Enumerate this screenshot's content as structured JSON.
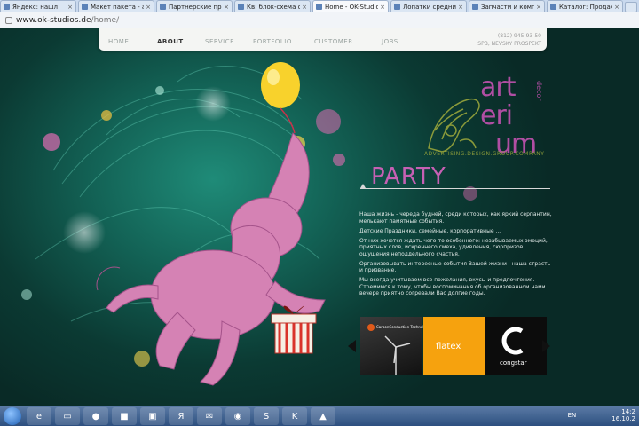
{
  "browser": {
    "tabs": [
      {
        "label": "Яндекс: нашл"
      },
      {
        "label": "Макет пакета - abit"
      },
      {
        "label": "Партнерские предл"
      },
      {
        "label": "Кв: блок-схема сло"
      },
      {
        "label": "Home - OK-Studios"
      },
      {
        "label": "Лопатки средние Рe"
      },
      {
        "label": "Запчасти и компле"
      },
      {
        "label": "Каталог: Продажа с"
      }
    ],
    "tab_close": "×",
    "url_host": "www.ok-studios.de",
    "url_path": "/home/"
  },
  "nav": {
    "items": [
      "HOME",
      "ABOUT",
      "SERVICE",
      "PORTFOLIO",
      "CUSTOMER",
      "JOBS"
    ],
    "active": "ABOUT",
    "phone": "(812) 945-93-50",
    "address": "SPB, NEVSKY PROSPEKT"
  },
  "logo": {
    "line1": "art",
    "line2": "eri",
    "line3": "um",
    "side": "decor",
    "tagline": "ADVERTISING.DESIGN.GROUP.COMPANY"
  },
  "party": {
    "title": "PARTY",
    "paragraphs": [
      "Наша жизнь - череда будней, среди которых, как яркий серпантин, мелькают памятные события.",
      "Детские Праздники, семейные, корпоративные ...",
      "От них хочется ждать чего-то особенного: незабываемых эмоций, приятных слов, искреннего смеха, удивления, сюрпризов.... ощущения неподдельного счастья.",
      "Организовывать интересные события Вашей жизни - наша страсть и призвание.",
      "Мы всегда учитываем все пожелания, вкусы и предпочтения. Стремимся к тому, чтобы воспоминания об организованном нами вечере приятно согревали Вас долгие годы."
    ]
  },
  "carousel": {
    "brands": [
      "CarbonConduction Technologies",
      "flatex",
      "congstar"
    ]
  },
  "taskbar": {
    "lang": "EN",
    "time": "14:2",
    "date": "16.10.2"
  },
  "colors": {
    "accent": "#c660b4",
    "logo_green": "#8a9a3a",
    "bg_teal": "#136356"
  }
}
